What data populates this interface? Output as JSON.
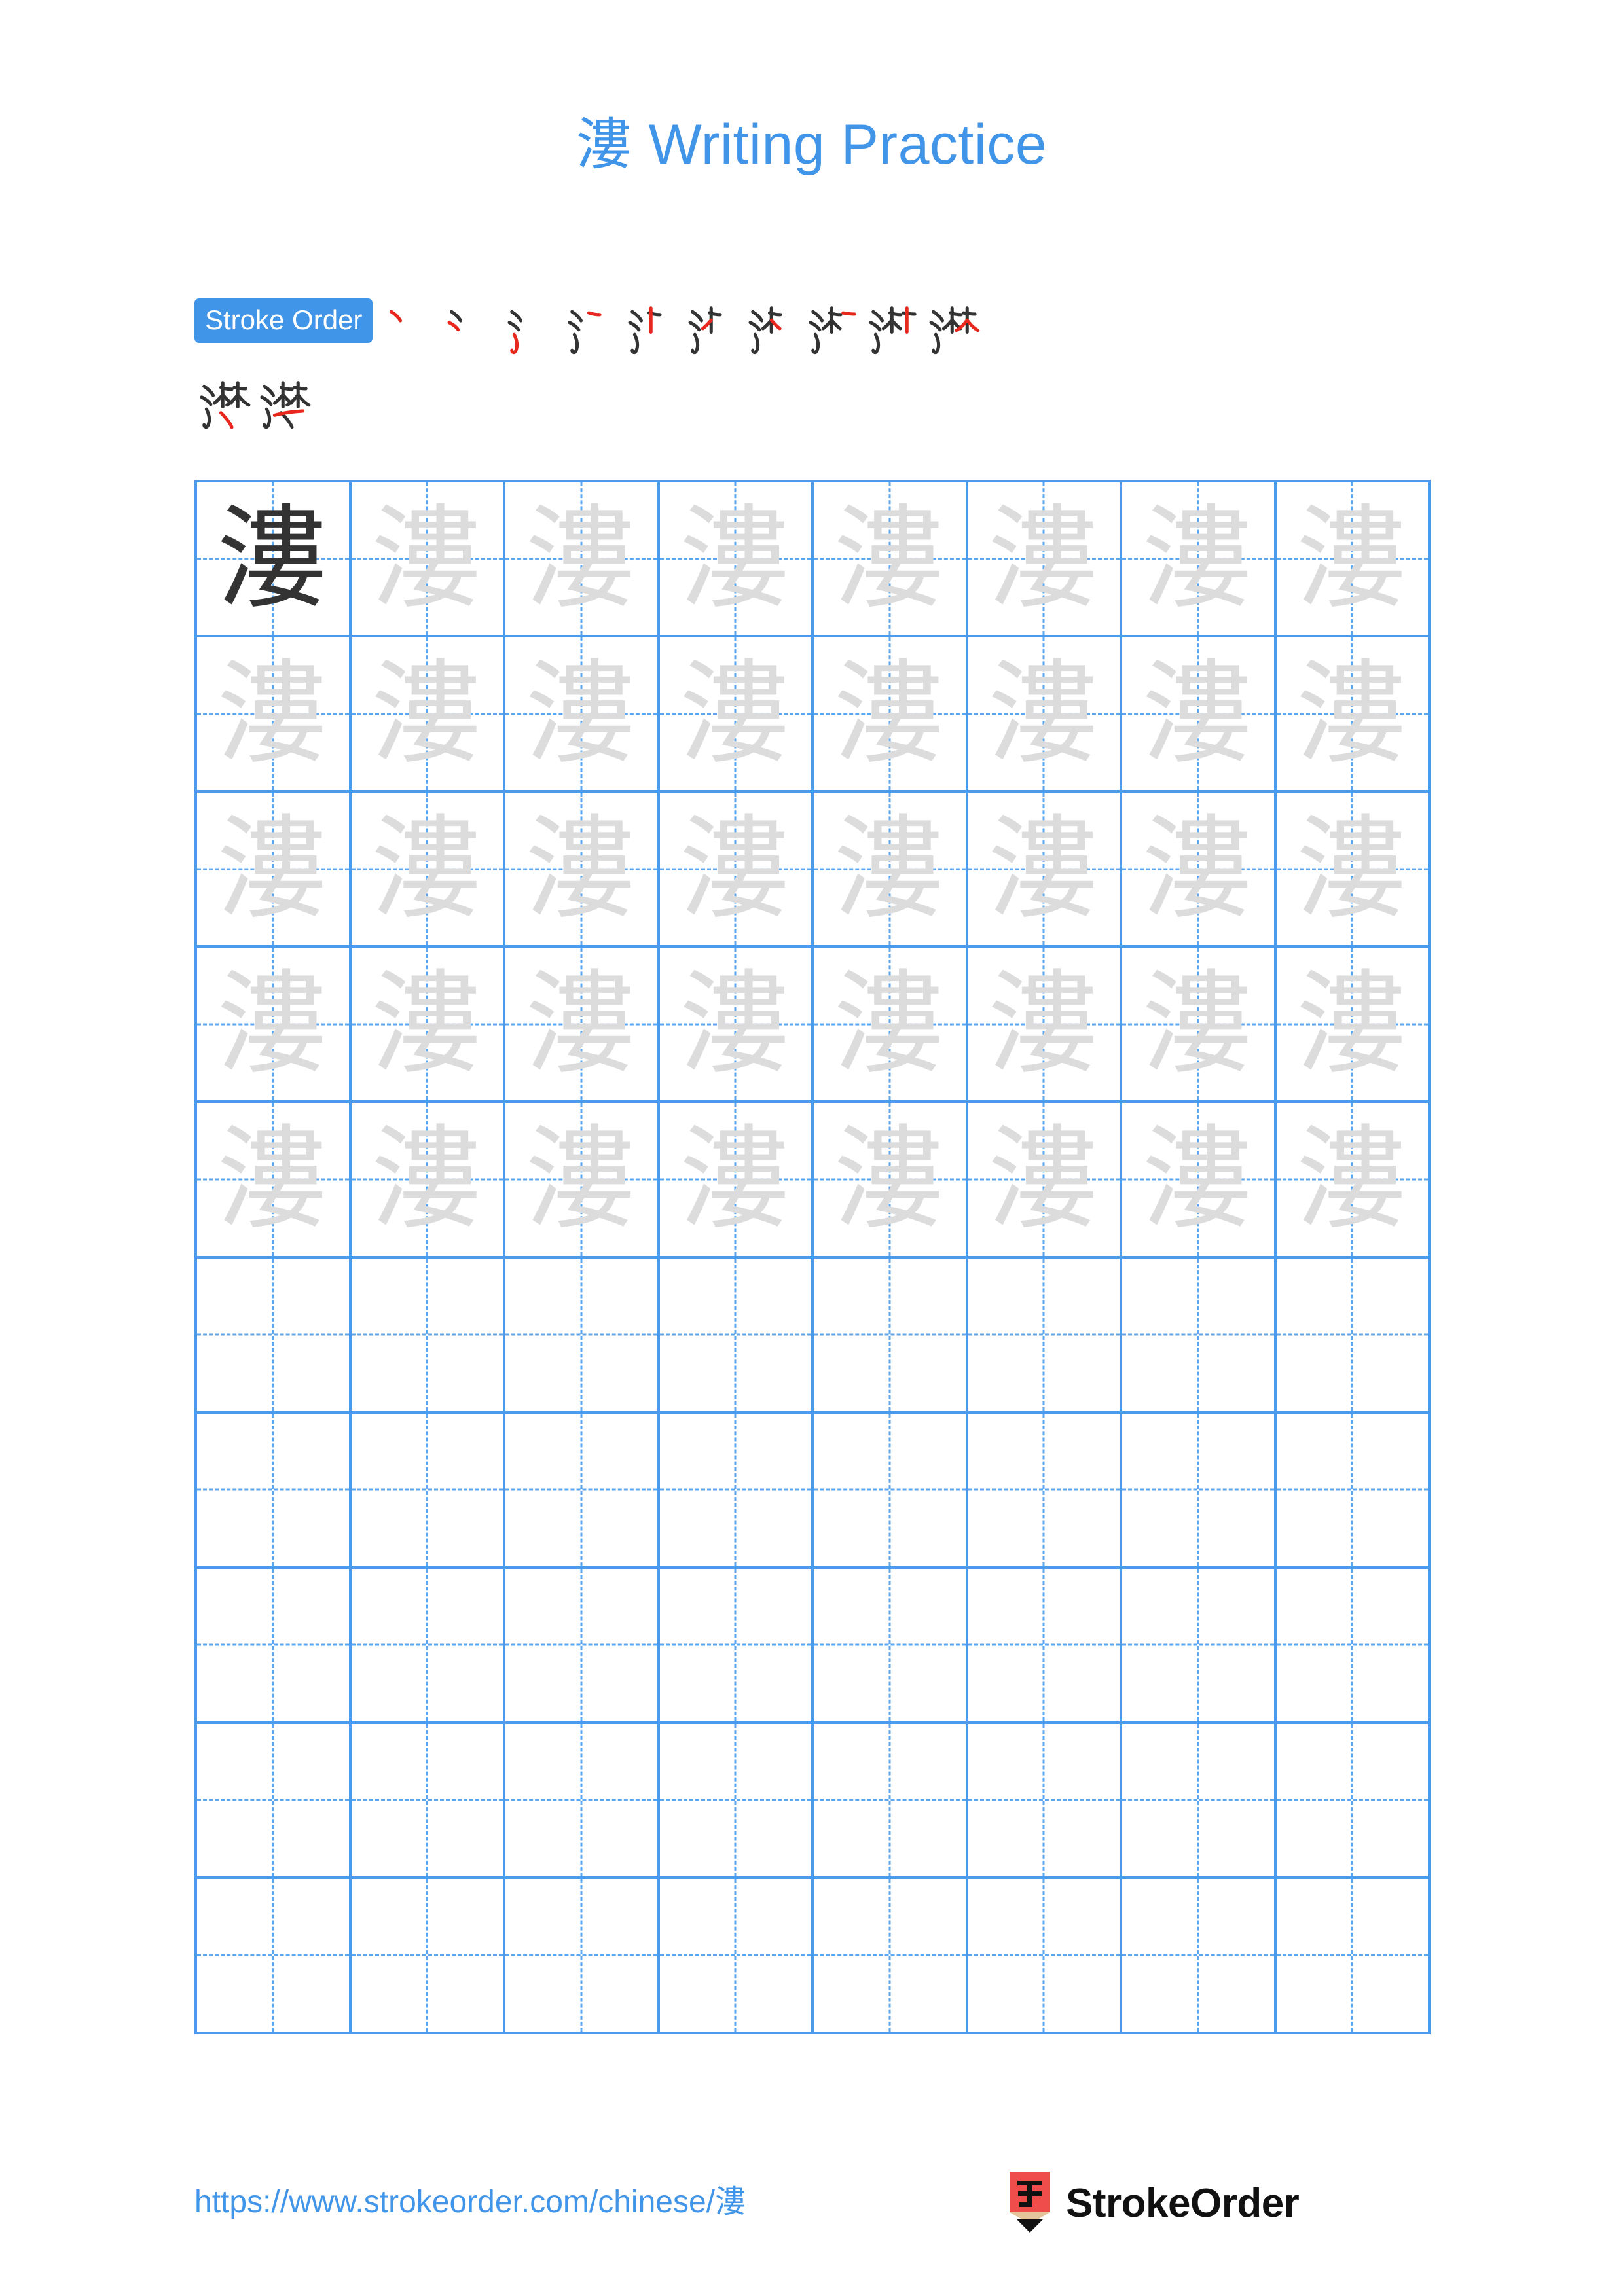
{
  "page": {
    "character": "漊",
    "title_suffix": " Writing Practice",
    "title_full": "漊 Writing Practice",
    "accent_blue": "#4195E8",
    "grid_blue": "#4A9BEE",
    "guide_blue": "#5BA6F0",
    "stroke_new_color": "#E8281E",
    "stroke_old_color": "#333333",
    "trace_gray": "#DCDCDC",
    "model_dark": "#333333",
    "logo_red": "#EF4C4C",
    "logo_tan": "#E3C49B"
  },
  "stroke_order": {
    "badge_label": "Stroke Order",
    "total_strokes": 12,
    "row1_count": 10,
    "row2_count": 2,
    "steps": [
      {
        "index": 1,
        "name": "stroke-step-1",
        "strokes_shown": 1
      },
      {
        "index": 2,
        "name": "stroke-step-2",
        "strokes_shown": 2
      },
      {
        "index": 3,
        "name": "stroke-step-3",
        "strokes_shown": 3
      },
      {
        "index": 4,
        "name": "stroke-step-4",
        "strokes_shown": 4
      },
      {
        "index": 5,
        "name": "stroke-step-5",
        "strokes_shown": 5
      },
      {
        "index": 6,
        "name": "stroke-step-6",
        "strokes_shown": 6
      },
      {
        "index": 7,
        "name": "stroke-step-7",
        "strokes_shown": 7
      },
      {
        "index": 8,
        "name": "stroke-step-8",
        "strokes_shown": 8
      },
      {
        "index": 9,
        "name": "stroke-step-9",
        "strokes_shown": 9
      },
      {
        "index": 10,
        "name": "stroke-step-10",
        "strokes_shown": 10
      },
      {
        "index": 11,
        "name": "stroke-step-11",
        "strokes_shown": 11
      },
      {
        "index": 12,
        "name": "stroke-step-12",
        "strokes_shown": 12
      }
    ]
  },
  "practice_grid": {
    "columns": 8,
    "rows": 10,
    "traced_rows": 5,
    "empty_rows": 5,
    "model_cell": {
      "row": 1,
      "column": 1,
      "char": "漊"
    },
    "cells": [
      [
        "漊",
        "漊",
        "漊",
        "漊",
        "漊",
        "漊",
        "漊",
        "漊"
      ],
      [
        "漊",
        "漊",
        "漊",
        "漊",
        "漊",
        "漊",
        "漊",
        "漊"
      ],
      [
        "漊",
        "漊",
        "漊",
        "漊",
        "漊",
        "漊",
        "漊",
        "漊"
      ],
      [
        "漊",
        "漊",
        "漊",
        "漊",
        "漊",
        "漊",
        "漊",
        "漊"
      ],
      [
        "漊",
        "漊",
        "漊",
        "漊",
        "漊",
        "漊",
        "漊",
        "漊"
      ],
      [
        "",
        "",
        "",
        "",
        "",
        "",
        "",
        ""
      ],
      [
        "",
        "",
        "",
        "",
        "",
        "",
        "",
        ""
      ],
      [
        "",
        "",
        "",
        "",
        "",
        "",
        "",
        ""
      ],
      [
        "",
        "",
        "",
        "",
        "",
        "",
        "",
        ""
      ],
      [
        "",
        "",
        "",
        "",
        "",
        "",
        "",
        ""
      ]
    ]
  },
  "footer": {
    "url": "https://www.strokeorder.com/chinese/漊",
    "brand_name": "StrokeOrder",
    "logo_char": "字"
  }
}
